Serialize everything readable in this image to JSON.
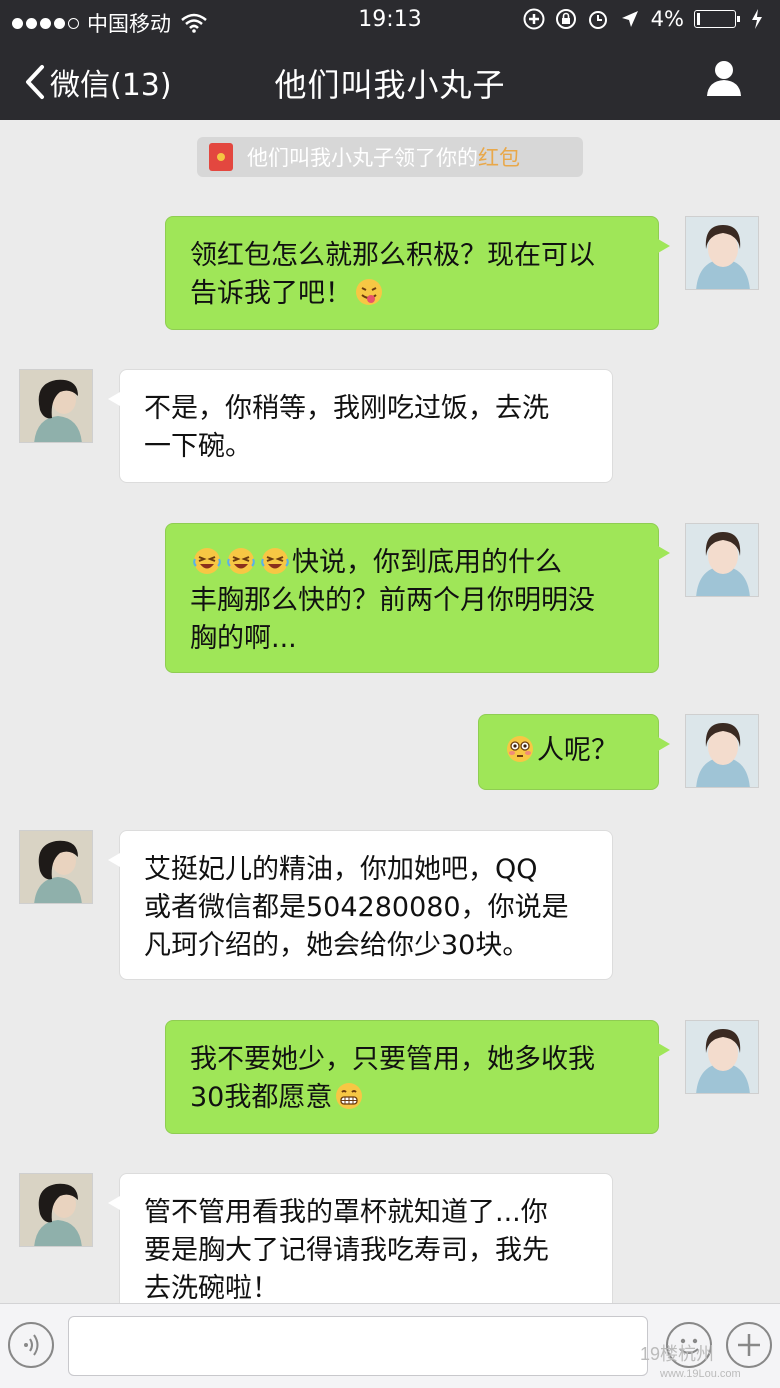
{
  "status_bar": {
    "carrier": "中国移动",
    "time": "19:13",
    "battery": "4%",
    "battery_level": 0.04
  },
  "nav": {
    "back_label": "微信(13)",
    "title": "他们叫我小丸子"
  },
  "system_notice": {
    "text": "他们叫我小丸子领了你的",
    "link": "红包"
  },
  "messages": [
    {
      "side": "me",
      "text_1": "领红包怎么就那么积极？现在可以",
      "text_2": "告诉我了吧！",
      "emoji": "tongue-out-emoji"
    },
    {
      "side": "them",
      "text_1": "不是，你稍等，我刚吃过饭，去洗",
      "text_2": "一下碗。"
    },
    {
      "side": "me",
      "emoji": "laughing-emoji",
      "text_1": "快说，你到底用的什么",
      "text_2": "丰胸那么快的？前两个月你明明没",
      "text_3": "胸的啊..."
    },
    {
      "side": "me",
      "emoji": "flushed-emoji",
      "text_1": "人呢？"
    },
    {
      "side": "them",
      "text_1": "艾挺妃儿的精油，你加她吧，QQ",
      "text_2": "或者微信都是504280080，你说是",
      "text_3": "凡珂介绍的，她会给你少30块。"
    },
    {
      "side": "me",
      "text_1": "我不要她少，只要管用，她多收我",
      "text_2": "30我都愿意",
      "emoji": "grin-emoji"
    },
    {
      "side": "them",
      "text_1": "管不管用看我的罩杯就知道了...你",
      "text_2": "要是胸大了记得请我吃寿司，我先",
      "text_3": "去洗碗啦！"
    }
  ],
  "watermark": {
    "main": "19楼杭州",
    "url": "www.19Lou.com"
  },
  "colors": {
    "nav_bg": "#2b2b2f",
    "chat_bg": "#ebebeb",
    "my_bubble": "#9fe658",
    "their_bubble": "#ffffff",
    "red_packet": "#e3473f",
    "link_orange": "#e9a84a"
  }
}
